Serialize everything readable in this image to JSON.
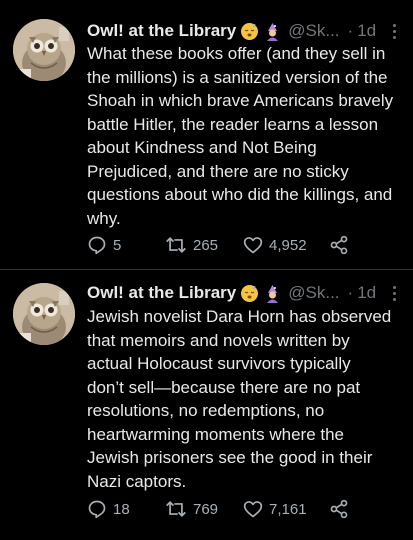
{
  "tweets": [
    {
      "author": {
        "display_name": "Owl! at the Library",
        "handle": "@Sk...",
        "emojis": [
          "sleeping-face-emoji",
          "mage-emoji"
        ],
        "avatar": "owl-avatar"
      },
      "separator": "·",
      "time": "1d",
      "text_lines": [
        "What these books offer (and they sell in",
        "the millions) is a sanitized version of the",
        "Shoah in which brave Americans bravely",
        "battle Hitler, the reader learns a lesson",
        "about Kindness and Not Being",
        "Prejudiced, and there are no sticky",
        "questions about who did the killings, and",
        "why."
      ],
      "actions": {
        "replies": "5",
        "retweets": "265",
        "likes": "4,952"
      }
    },
    {
      "author": {
        "display_name": "Owl! at the Library",
        "handle": "@Sk...",
        "emojis": [
          "sleeping-face-emoji",
          "mage-emoji"
        ],
        "avatar": "owl-avatar"
      },
      "separator": "·",
      "time": "1d",
      "text_lines": [
        "Jewish novelist Dara Horn has observed",
        "that memoirs and novels written by",
        "actual Holocaust survivors typically",
        "don’t sell—because there are no pat",
        "resolutions, no redemptions, no",
        "heartwarming moments where the",
        "Jewish prisoners see the good in their",
        "Nazi captors."
      ],
      "actions": {
        "replies": "18",
        "retweets": "769",
        "likes": "7,161"
      }
    }
  ],
  "colors": {
    "background": "#000000",
    "text_primary": "#e7e9ea",
    "text_secondary": "#71767b",
    "divider": "#2f3336"
  }
}
